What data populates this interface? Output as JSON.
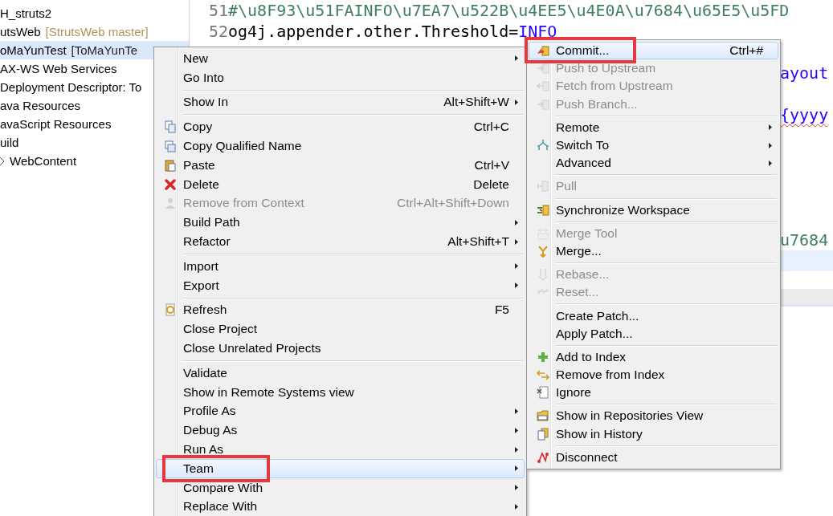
{
  "project_tree": {
    "items": [
      {
        "label": "H_struts2",
        "selected": false,
        "collapsed": false
      },
      {
        "label": "utsWeb",
        "decoration": "[StrutsWeb master]",
        "selected": false,
        "collapsed": false
      },
      {
        "label": "oMaYunTest",
        "decoration": "[ToMaYunTe",
        "selected": true,
        "collapsed": false
      },
      {
        "label": "AX-WS Web Services",
        "selected": false,
        "collapsed": false
      },
      {
        "label": "Deployment Descriptor: To",
        "selected": false,
        "collapsed": false
      },
      {
        "label": "ava Resources",
        "selected": false,
        "collapsed": false
      },
      {
        "label": "avaScript Resources",
        "selected": false,
        "collapsed": false
      },
      {
        "label": "uild",
        "selected": false,
        "collapsed": false
      },
      {
        "label": "WebContent",
        "selected": false,
        "collapsed": true
      }
    ]
  },
  "editor": {
    "lines": [
      {
        "number": "51",
        "current": false,
        "tokens": [
          {
            "kind": "comment",
            "text": "#\\u8F93\\u51FAINFO\\u7EA7\\u522B\\u4EE5\\u4E0A\\u7684\\u65E5\\u5FD",
            "flagged": false
          }
        ]
      },
      {
        "number": "52",
        "current": false,
        "tokens": [
          {
            "kind": "plain",
            "text": "og4j.appender.other.Threshold=",
            "flagged": false
          },
          {
            "kind": "value",
            "text": "INFO",
            "flagged": false
          }
        ]
      },
      {
        "current": false
      },
      {
        "current": false,
        "tail": [
          {
            "kind": "value",
            "text": "ayout",
            "flagged": false
          }
        ]
      },
      {
        "current": false
      },
      {
        "current": false,
        "tail": [
          {
            "kind": "value",
            "text": "{yyyy",
            "flagged": true
          }
        ]
      },
      {
        "current": false
      },
      {
        "current": false
      },
      {
        "current": false
      },
      {
        "current": false
      },
      {
        "current": false
      },
      {
        "current": false,
        "tail": [
          {
            "kind": "comment",
            "text": "u7684",
            "flagged": false
          }
        ]
      },
      {
        "current": true
      }
    ]
  },
  "context_menu": {
    "items": [
      {
        "kind": "item",
        "label": "New",
        "submenu": true,
        "disabled": false,
        "highlighted": false,
        "annotated": false
      },
      {
        "kind": "item",
        "label": "Go Into",
        "submenu": false,
        "disabled": false,
        "highlighted": false,
        "annotated": false
      },
      {
        "kind": "separator"
      },
      {
        "kind": "item",
        "label": "Show In",
        "shortcut": "Alt+Shift+W",
        "submenu": true,
        "disabled": false,
        "highlighted": false,
        "annotated": false
      },
      {
        "kind": "separator"
      },
      {
        "kind": "item",
        "label": "Copy",
        "shortcut": "Ctrl+C",
        "submenu": false,
        "disabled": false,
        "highlighted": false,
        "annotated": false
      },
      {
        "kind": "item",
        "label": "Copy Qualified Name",
        "submenu": false,
        "disabled": false,
        "highlighted": false,
        "annotated": false
      },
      {
        "kind": "item",
        "label": "Paste",
        "shortcut": "Ctrl+V",
        "submenu": false,
        "disabled": false,
        "highlighted": false,
        "annotated": false
      },
      {
        "kind": "item",
        "label": "Delete",
        "shortcut": "Delete",
        "submenu": false,
        "disabled": false,
        "highlighted": false,
        "annotated": false
      },
      {
        "kind": "item",
        "label": "Remove from Context",
        "shortcut": "Ctrl+Alt+Shift+Down",
        "submenu": false,
        "disabled": true,
        "highlighted": false,
        "annotated": false
      },
      {
        "kind": "item",
        "label": "Build Path",
        "submenu": true,
        "disabled": false,
        "highlighted": false,
        "annotated": false
      },
      {
        "kind": "item",
        "label": "Refactor",
        "shortcut": "Alt+Shift+T",
        "submenu": true,
        "disabled": false,
        "highlighted": false,
        "annotated": false
      },
      {
        "kind": "separator"
      },
      {
        "kind": "item",
        "label": "Import",
        "submenu": true,
        "disabled": false,
        "highlighted": false,
        "annotated": false
      },
      {
        "kind": "item",
        "label": "Export",
        "submenu": true,
        "disabled": false,
        "highlighted": false,
        "annotated": false
      },
      {
        "kind": "separator"
      },
      {
        "kind": "item",
        "label": "Refresh",
        "shortcut": "F5",
        "submenu": false,
        "disabled": false,
        "highlighted": false,
        "annotated": false
      },
      {
        "kind": "item",
        "label": "Close Project",
        "submenu": false,
        "disabled": false,
        "highlighted": false,
        "annotated": false
      },
      {
        "kind": "item",
        "label": "Close Unrelated Projects",
        "submenu": false,
        "disabled": false,
        "highlighted": false,
        "annotated": false
      },
      {
        "kind": "separator"
      },
      {
        "kind": "item",
        "label": "Validate",
        "submenu": false,
        "disabled": false,
        "highlighted": false,
        "annotated": false
      },
      {
        "kind": "item",
        "label": "Show in Remote Systems view",
        "submenu": false,
        "disabled": false,
        "highlighted": false,
        "annotated": false
      },
      {
        "kind": "item",
        "label": "Profile As",
        "submenu": true,
        "disabled": false,
        "highlighted": false,
        "annotated": false
      },
      {
        "kind": "item",
        "label": "Debug As",
        "submenu": true,
        "disabled": false,
        "highlighted": false,
        "annotated": false
      },
      {
        "kind": "item",
        "label": "Run As",
        "submenu": true,
        "disabled": false,
        "highlighted": false,
        "annotated": false
      },
      {
        "kind": "item",
        "label": "Team",
        "submenu": true,
        "disabled": false,
        "highlighted": true,
        "annotated": true
      },
      {
        "kind": "item",
        "label": "Compare With",
        "submenu": true,
        "disabled": false,
        "highlighted": false,
        "annotated": false
      },
      {
        "kind": "item",
        "label": "Replace With",
        "submenu": true,
        "disabled": false,
        "highlighted": false,
        "annotated": false
      }
    ]
  },
  "team_submenu": {
    "items": [
      {
        "kind": "item",
        "label": "Commit...",
        "shortcut": "Ctrl+#",
        "submenu": false,
        "disabled": false,
        "highlighted": true,
        "annotated": true
      },
      {
        "kind": "item",
        "label": "Push to Upstream",
        "submenu": false,
        "disabled": true,
        "highlighted": false,
        "annotated": false
      },
      {
        "kind": "item",
        "label": "Fetch from Upstream",
        "submenu": false,
        "disabled": true,
        "highlighted": false,
        "annotated": false
      },
      {
        "kind": "item",
        "label": "Push Branch...",
        "submenu": false,
        "disabled": true,
        "highlighted": false,
        "annotated": false
      },
      {
        "kind": "separator"
      },
      {
        "kind": "item",
        "label": "Remote",
        "submenu": true,
        "disabled": false,
        "highlighted": false,
        "annotated": false
      },
      {
        "kind": "item",
        "label": "Switch To",
        "submenu": true,
        "disabled": false,
        "highlighted": false,
        "annotated": false
      },
      {
        "kind": "item",
        "label": "Advanced",
        "submenu": true,
        "disabled": false,
        "highlighted": false,
        "annotated": false
      },
      {
        "kind": "separator"
      },
      {
        "kind": "item",
        "label": "Pull",
        "submenu": false,
        "disabled": true,
        "highlighted": false,
        "annotated": false
      },
      {
        "kind": "separator"
      },
      {
        "kind": "item",
        "label": "Synchronize Workspace",
        "submenu": false,
        "disabled": false,
        "highlighted": false,
        "annotated": false
      },
      {
        "kind": "separator"
      },
      {
        "kind": "item",
        "label": "Merge Tool",
        "submenu": false,
        "disabled": true,
        "highlighted": false,
        "annotated": false
      },
      {
        "kind": "item",
        "label": "Merge...",
        "submenu": false,
        "disabled": false,
        "highlighted": false,
        "annotated": false
      },
      {
        "kind": "separator"
      },
      {
        "kind": "item",
        "label": "Rebase...",
        "submenu": false,
        "disabled": true,
        "highlighted": false,
        "annotated": false
      },
      {
        "kind": "item",
        "label": "Reset...",
        "submenu": false,
        "disabled": true,
        "highlighted": false,
        "annotated": false
      },
      {
        "kind": "separator"
      },
      {
        "kind": "item",
        "label": "Create Patch...",
        "submenu": false,
        "disabled": false,
        "highlighted": false,
        "annotated": false
      },
      {
        "kind": "item",
        "label": "Apply Patch...",
        "submenu": false,
        "disabled": false,
        "highlighted": false,
        "annotated": false
      },
      {
        "kind": "separator"
      },
      {
        "kind": "item",
        "label": "Add to Index",
        "submenu": false,
        "disabled": false,
        "highlighted": false,
        "annotated": false
      },
      {
        "kind": "item",
        "label": "Remove from Index",
        "submenu": false,
        "disabled": false,
        "highlighted": false,
        "annotated": false
      },
      {
        "kind": "item",
        "label": "Ignore",
        "submenu": false,
        "disabled": false,
        "highlighted": false,
        "annotated": false
      },
      {
        "kind": "separator"
      },
      {
        "kind": "item",
        "label": "Show in Repositories View",
        "submenu": false,
        "disabled": false,
        "highlighted": false,
        "annotated": false
      },
      {
        "kind": "item",
        "label": "Show in History",
        "submenu": false,
        "disabled": false,
        "highlighted": false,
        "annotated": false
      },
      {
        "kind": "separator"
      },
      {
        "kind": "item",
        "label": "Disconnect",
        "submenu": false,
        "disabled": false,
        "highlighted": false,
        "annotated": false
      }
    ]
  }
}
